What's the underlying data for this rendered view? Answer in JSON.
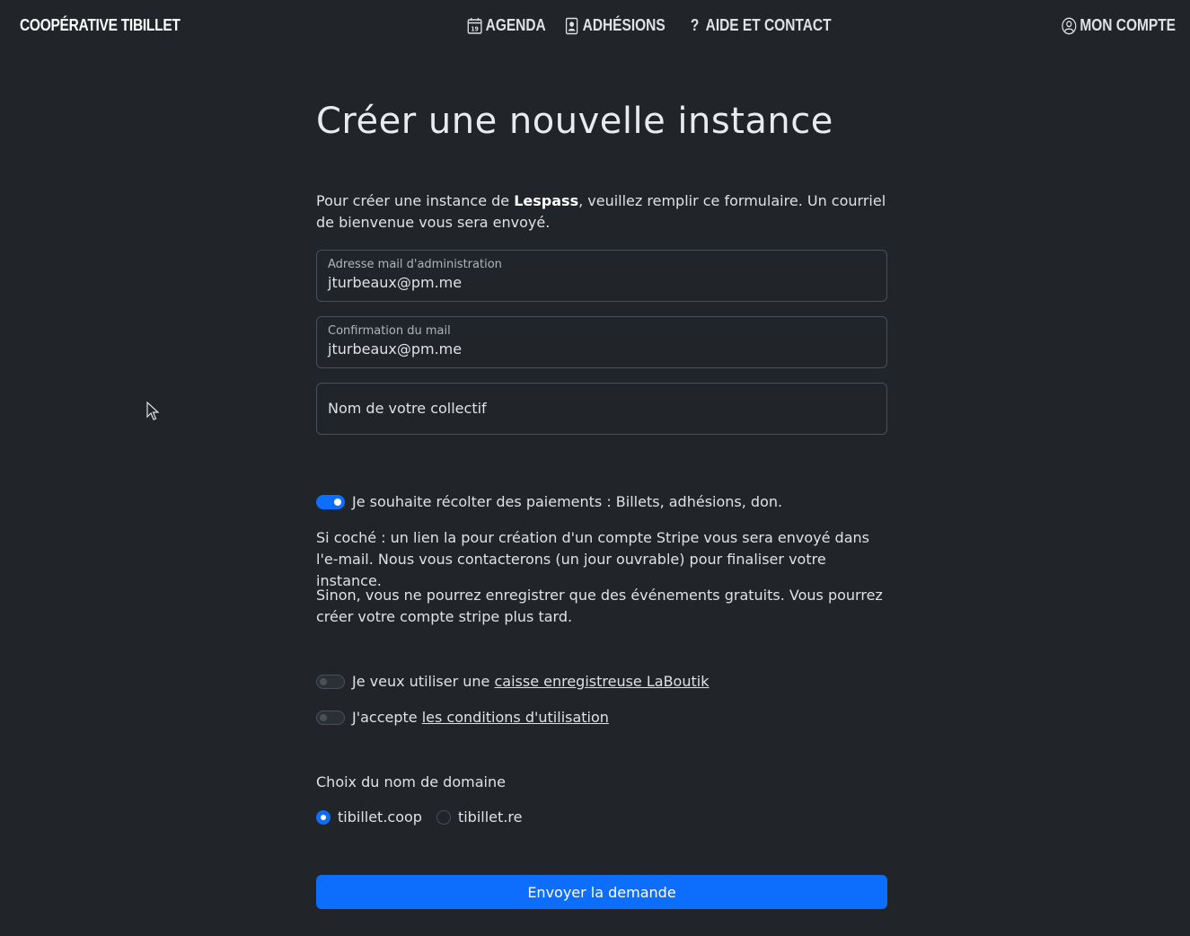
{
  "navbar": {
    "brand": "COOPÉRATIVE TIBILLET",
    "links": [
      {
        "label": "AGENDA",
        "icon": "calendar-icon"
      },
      {
        "label": "ADHÉSIONS",
        "icon": "id-card-icon"
      },
      {
        "label": "AIDE ET CONTACT",
        "icon": "question-icon"
      }
    ],
    "account": {
      "label": "MON COMPTE",
      "icon": "user-circle-icon"
    },
    "calendar_day": "19"
  },
  "page": {
    "title": "Créer une nouvelle instance",
    "intro_pre": "Pour créer une instance de ",
    "intro_bold": "Lespass",
    "intro_post": ", veuillez remplir ce formulaire. Un courriel de bienvenue vous sera envoyé."
  },
  "form": {
    "email": {
      "label": "Adresse mail d'administration",
      "value": "jturbeaux@pm.me"
    },
    "email_confirm": {
      "label": "Confirmation du mail",
      "value": "jturbeaux@pm.me"
    },
    "collective": {
      "placeholder": "Nom de votre collectif"
    },
    "payments_toggle": {
      "label": "Je souhaite récolter des paiements : Billets, adhésions, don.",
      "checked": true
    },
    "payments_info_1": "Si coché : un lien la pour création d'un compte Stripe vous sera envoyé dans l'e-mail. Nous vous contacterons (un jour ouvrable) pour finaliser votre instance.",
    "payments_info_2": "Sinon, vous ne pourrez enregistrer que des événements gratuits. Vous pourrez créer votre compte stripe plus tard.",
    "laboutik_toggle": {
      "pre": "Je veux utiliser une ",
      "link": "caisse enregistreuse LaBoutik",
      "checked": false
    },
    "terms_toggle": {
      "pre": "J'accepte ",
      "link": "les conditions d'utilisation",
      "checked": false
    },
    "domain_label": "Choix du nom de domaine",
    "domains": [
      {
        "label": "tibillet.coop",
        "selected": true
      },
      {
        "label": "tibillet.re",
        "selected": false
      }
    ],
    "submit": "Envoyer la demande"
  },
  "colors": {
    "background": "#212529",
    "accent": "#0d6efd",
    "text": "#dee2e6"
  }
}
